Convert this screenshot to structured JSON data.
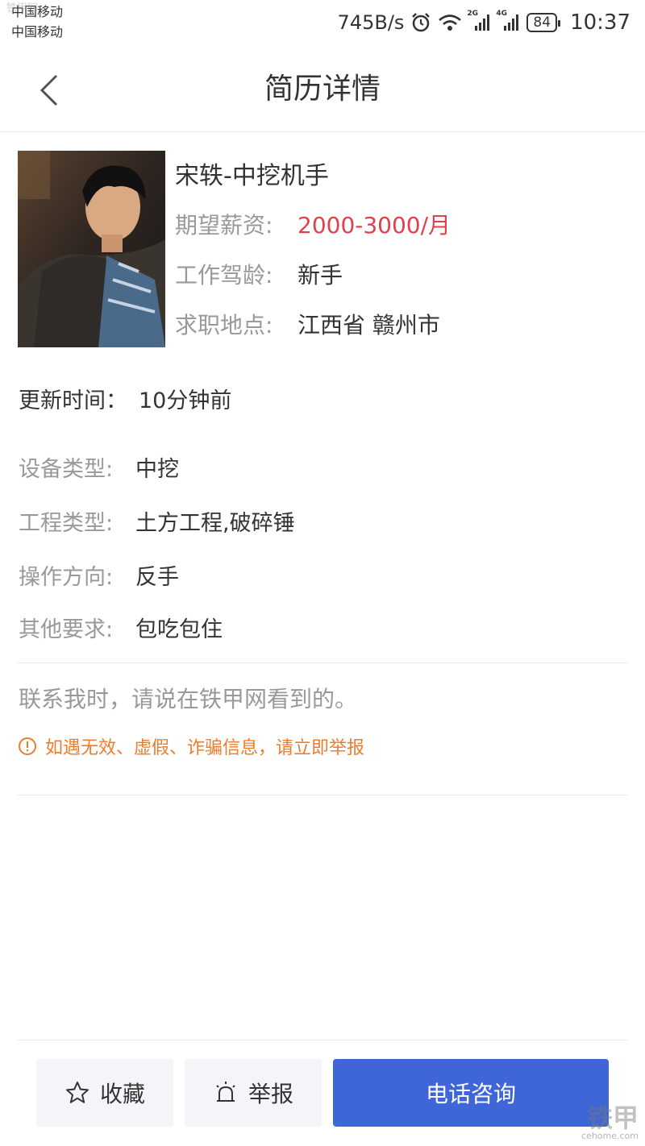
{
  "status_bar": {
    "carrier_1": "中国移动",
    "carrier_2": "中国移动",
    "net_speed": "745B/s",
    "net_2g": "2G",
    "net_4g": "4G",
    "battery": "84",
    "time": "10:37"
  },
  "header": {
    "title": "简历详情"
  },
  "profile": {
    "name": "宋轶-中挖机手",
    "salary_label": "期望薪资:",
    "salary_value": "2000-3000/月",
    "experience_label": "工作驾龄:",
    "experience_value": "新手",
    "location_label": "求职地点:",
    "location_value": "江西省 赣州市"
  },
  "update": {
    "label": "更新时间：",
    "value": "10分钟前"
  },
  "details": [
    {
      "label": "设备类型:",
      "value": "中挖"
    },
    {
      "label": "工程类型:",
      "value": "土方工程,破碎锤"
    },
    {
      "label": "操作方向:",
      "value": "反手"
    },
    {
      "label": "其他要求:",
      "value": "包吃包住"
    }
  ],
  "contact_note": "联系我时，请说在铁甲网看到的。",
  "report_tip": "如遇无效、虚假、诈骗信息，请立即举报",
  "bottom_bar": {
    "favorite_label": "收藏",
    "report_label": "举报",
    "call_label": "电话咨询"
  },
  "watermark": {
    "top_left": "铁甲网",
    "logo": "铁甲",
    "url": "cehome.com"
  },
  "colors": {
    "salary": "#e0424b",
    "warning": "#f07c2a",
    "primary_button": "#3e66d8",
    "label_gray": "#999999"
  }
}
